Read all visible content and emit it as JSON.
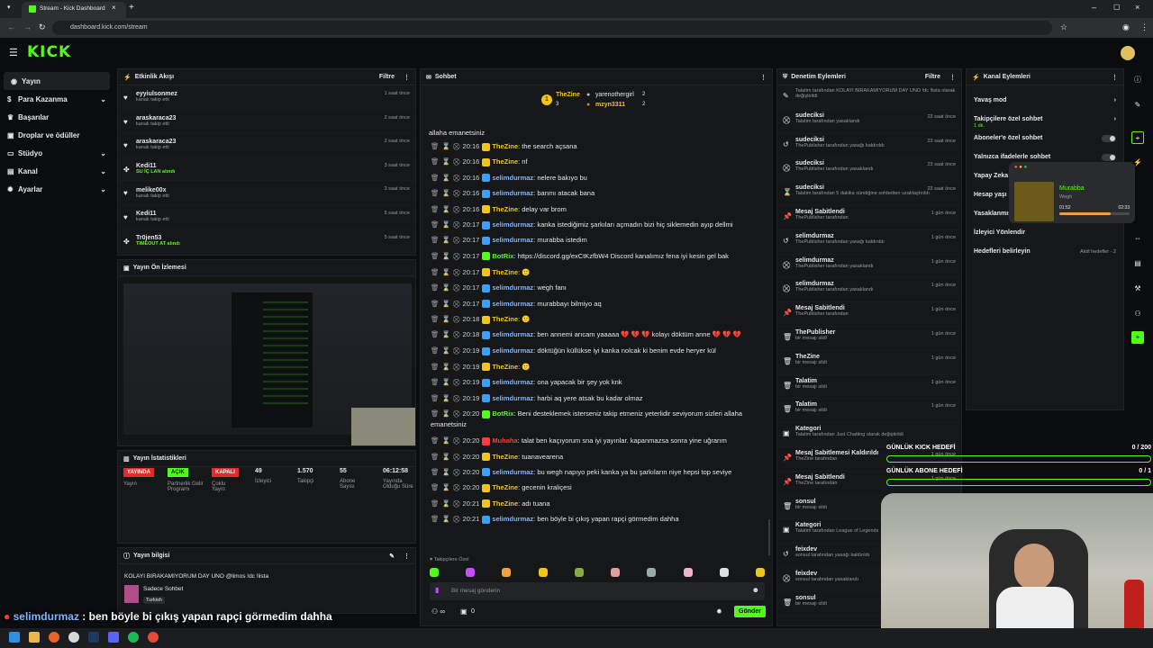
{
  "browser": {
    "tab_title": "Stream - Kick Dashboard",
    "url": "dashboard.kick.com/stream"
  },
  "brand": {
    "logo": "KICK",
    "accent": "#53fc18"
  },
  "nav": {
    "items": [
      {
        "label": "Yayın",
        "icon": "broadcast-icon"
      },
      {
        "label": "Para Kazanma",
        "icon": "money-icon"
      },
      {
        "label": "Başarılar",
        "icon": "trophy-icon"
      },
      {
        "label": "Droplar ve ödüller",
        "icon": "gift-icon"
      },
      {
        "label": "Stüdyo",
        "icon": "studio-icon"
      },
      {
        "label": "Kanal",
        "icon": "channel-icon"
      },
      {
        "label": "Ayarlar",
        "icon": "gear-icon"
      }
    ]
  },
  "activity": {
    "title": "Etkinlik Akışı",
    "filter": "Filtre",
    "rows": [
      {
        "name": "eyyiulsonmez",
        "sub": "kanalı takip etti",
        "time": "1 saat önce"
      },
      {
        "name": "araskaraca23",
        "sub": "kanalı takip etti",
        "time": "2 saat önce"
      },
      {
        "name": "araskaraca23",
        "sub": "kanalı takip etti",
        "time": "2 saat önce"
      },
      {
        "name": "Kedi11",
        "sub": "SU İÇ LAN alındı",
        "time": "3 saat önce"
      },
      {
        "name": "melike00x",
        "sub": "kanalı takip etti",
        "time": "3 saat önce"
      },
      {
        "name": "Kedi11",
        "sub": "kanalı takip etti",
        "time": "5 saat önce"
      },
      {
        "name": "Tr0jen53",
        "sub": "TIMEOUT AT alındı",
        "time": "5 saat önce"
      }
    ]
  },
  "preview": {
    "title": "Yayın Ön İzlemesi"
  },
  "stats": {
    "title": "Yayın İstatistikleri",
    "items": [
      {
        "value": "YAYINDA",
        "label": "Yayın"
      },
      {
        "value": "AÇIK",
        "label": "Partnerlik Gelir Programı"
      },
      {
        "value": "KAPALI",
        "label": "Çoklu Yayın"
      },
      {
        "value": "49",
        "label": "İzleyici"
      },
      {
        "value": "1.570",
        "label": "Takipçi"
      },
      {
        "value": "55",
        "label": "Abone Sayısı"
      },
      {
        "value": "06:12:58",
        "label": "Yayında Olduğu Süre"
      }
    ]
  },
  "info": {
    "title": "Yayın bilgisi",
    "stream_title": "KOLAYI BIRAKAMIYORUM DAY UNO @limos !dc !lista",
    "category": "Sadece Sohbet",
    "language": "Turkish"
  },
  "chat": {
    "title": "Sohbet",
    "top": [
      {
        "name": "TheZine",
        "count": "3"
      },
      {
        "name": "yarenothergirl",
        "count": "2"
      },
      {
        "name": "mzyn3311",
        "count": "2"
      }
    ],
    "partial": "allaha emanetsiniz",
    "messages": [
      {
        "time": "20:16",
        "user": "TheZine",
        "cls": "u1",
        "text": "the search açsana"
      },
      {
        "time": "20:16",
        "user": "TheZine",
        "cls": "u1",
        "text": "nf"
      },
      {
        "time": "20:16",
        "user": "selimdurmaz",
        "cls": "u2",
        "text": "nelere bakıyo bu"
      },
      {
        "time": "20:16",
        "user": "selimdurmaz",
        "cls": "u2",
        "text": "banmı atacak bana"
      },
      {
        "time": "20:16",
        "user": "TheZine",
        "cls": "u1",
        "text": "delay var brom"
      },
      {
        "time": "20:17",
        "user": "selimdurmaz",
        "cls": "u2",
        "text": "kanka istediğimiz şarkıları açmadın bizi hiç sikle­medin ayıp dellmi"
      },
      {
        "time": "20:17",
        "user": "selimdurmaz",
        "cls": "u2",
        "text": "murabba istedim"
      },
      {
        "time": "20:17",
        "user": "BotRix",
        "cls": "u3",
        "text": "https://discord.gg/exCtKzfbW4 Discord kanalımız fena iyi kesin gel bak",
        "wrap": true
      },
      {
        "time": "20:17",
        "user": "TheZine",
        "cls": "u1",
        "text": "🙂"
      },
      {
        "time": "20:17",
        "user": "selimdurmaz",
        "cls": "u2",
        "text": "wegh fanı"
      },
      {
        "time": "20:17",
        "user": "selimdurmaz",
        "cls": "u2",
        "text": "murabbayı bilmiyo aq"
      },
      {
        "time": "20:18",
        "user": "TheZine",
        "cls": "u1",
        "text": "🙂"
      },
      {
        "time": "20:18",
        "user": "selimdurmaz",
        "cls": "u2",
        "text": "ben annemi arıcam yaaaaa 💔 💔 💔 kolayı döktüm anne 💔 💔 💔",
        "wrap": true
      },
      {
        "time": "20:19",
        "user": "selimdurmaz",
        "cls": "u2",
        "text": "döktüğün küllükse iyi kanka nolcak ki benim evde heryer kül"
      },
      {
        "time": "20:19",
        "user": "TheZine",
        "cls": "u1",
        "text": "🙂"
      },
      {
        "time": "20:19",
        "user": "selimdurmaz",
        "cls": "u2",
        "text": "ona yapacak bir şey yok knk"
      },
      {
        "time": "20:19",
        "user": "selimdurmaz",
        "cls": "u2",
        "text": "harbi aq yere atsak bu kadar olmaz"
      },
      {
        "time": "20:20",
        "user": "BotRix",
        "cls": "u3",
        "text": "Beni desteklemek isterseniz takip etmeniz yeterlidir seviyorum sizleri allaha emanetsiniz",
        "wrap": true
      },
      {
        "time": "20:20",
        "user": "Muhaha",
        "cls": "u4",
        "text": "talat ben kaçıyorum sna iyi yayınlar. kapanmazsa sonra yine uğrarım"
      },
      {
        "time": "20:20",
        "user": "TheZine",
        "cls": "u1",
        "text": "tuanavearena"
      },
      {
        "time": "20:20",
        "user": "selimdurmaz",
        "cls": "u2",
        "text": "bu wegh napıyo peki kanka ya bu şarkıların niye hepsi top seviye"
      },
      {
        "time": "20:20",
        "user": "TheZine",
        "cls": "u1",
        "text": "gecenin kraliçesi"
      },
      {
        "time": "20:21",
        "user": "TheZine",
        "cls": "u1",
        "text": "adı tuana"
      },
      {
        "time": "20:21",
        "user": "selimdurmaz",
        "cls": "u2",
        "text": "ben böyle bi çıkış yapan rapçi görmedim dahha"
      }
    ],
    "emote_label": "Takipçilere Özel",
    "input_placeholder": "Bir mesaj gönderin",
    "send": "Gönder",
    "counter": "0"
  },
  "moderation": {
    "title": "Denetim Eylemleri",
    "filter": "Filtre",
    "rows": [
      {
        "name": "",
        "sub": "Talatim tarafından KOLAYI BIRAKAMIYORUM DAY UNO !dc !lista olarak değiştirildi",
        "time": ""
      },
      {
        "name": "sudeciksi",
        "sub": "Talatim tarafından yasaklandı",
        "time": "23 saat önce"
      },
      {
        "name": "sudeciksi",
        "sub": "ThePublisher tarafından yasağı kaldırıldı",
        "time": "23 saat önce"
      },
      {
        "name": "sudeciksi",
        "sub": "ThePublisher tarafından yasaklandı",
        "time": "23 saat önce"
      },
      {
        "name": "sudeciksi",
        "sub": "Talatim tarafından 5 dakika süreliğine sohbetten uzaklaştırıldı",
        "time": "23 saat önce"
      },
      {
        "name": "Mesaj Sabitlendi",
        "sub": "ThePublisher tarafından",
        "time": "1 gün önce"
      },
      {
        "name": "selimdurmaz",
        "sub": "ThePublisher tarafından yasağı kaldırıldı",
        "time": "1 gün önce"
      },
      {
        "name": "selimdurmaz",
        "sub": "ThePublisher tarafından yasaklandı",
        "time": "1 gün önce"
      },
      {
        "name": "selimdurmaz",
        "sub": "ThePublisher tarafından yasaklandı",
        "time": "1 gün önce"
      },
      {
        "name": "Mesaj Sabitlendi",
        "sub": "ThePublisher tarafından",
        "time": "1 gün önce"
      },
      {
        "name": "ThePublisher",
        "sub": "bir mesajı sildi",
        "time": "1 gün önce"
      },
      {
        "name": "TheZine",
        "sub": "bir mesajı sildi",
        "time": "1 gün önce"
      },
      {
        "name": "Talatim",
        "sub": "bir mesajı sildi",
        "time": "1 gün önce"
      },
      {
        "name": "Talatim",
        "sub": "bir mesajı sildi",
        "time": "1 gün önce"
      },
      {
        "name": "Kategori",
        "sub": "Talatim tarafından Just Chatting olarak değiştirildi",
        "time": ""
      },
      {
        "name": "Mesaj Sabitlemesi Kaldırıldı",
        "sub": "TheZine tarafından",
        "time": "1 gün önce"
      },
      {
        "name": "Mesaj Sabitlendi",
        "sub": "TheZine tarafından",
        "time": "1 gün önce"
      },
      {
        "name": "sonsul",
        "sub": "bir mesajı sildi",
        "time": ""
      },
      {
        "name": "Kategori",
        "sub": "Talatim tarafından League of Legends",
        "time": ""
      },
      {
        "name": "feixdev",
        "sub": "sonsul tarafından yasağı kaldırıldı",
        "time": ""
      },
      {
        "name": "feixdev",
        "sub": "sonsul tarafından yasaklandı",
        "time": ""
      },
      {
        "name": "sonsul",
        "sub": "bir mesajı sildi",
        "time": ""
      }
    ]
  },
  "channel": {
    "title": "Kanal Eylemleri",
    "rows": [
      {
        "label": "Yavaş mod",
        "ctl": "›"
      },
      {
        "label": "Takipçilere özel sohbet",
        "ctl": "›"
      },
      {
        "label": "Aboneler'e özel sohbet",
        "ctl": "toggle"
      },
      {
        "label": "Yalnızca ifadelerle sohbet",
        "ctl": "toggle"
      },
      {
        "label": "Yapay Zeka",
        "ctl": ""
      },
      {
        "label": "Hesap yaşı k",
        "ctl": ""
      },
      {
        "label": "Yasaklanmış",
        "ctl": ""
      },
      {
        "label": "İzleyici Yönlendir",
        "ctl": ""
      },
      {
        "label": "Hedefleri belirleyin",
        "ctl": "Aktif hedefler - 2"
      }
    ],
    "sub_small": "1 dk."
  },
  "music": {
    "title": "Murabba",
    "artist": "Wegh",
    "elapsed": "01:52",
    "total": "02:33",
    "progress": 0.73
  },
  "goals": [
    {
      "label": "GÜNLÜK KICK HEDEFİ",
      "value": "0 / 200"
    },
    {
      "label": "GÜNLÜK ABONE HEDEFİ",
      "value": "0 / 1"
    }
  ],
  "overlay_chat": {
    "user": "selimdurmaz",
    "text": ": ben böyle bi çıkış yapan rapçi görmedim dahha"
  }
}
